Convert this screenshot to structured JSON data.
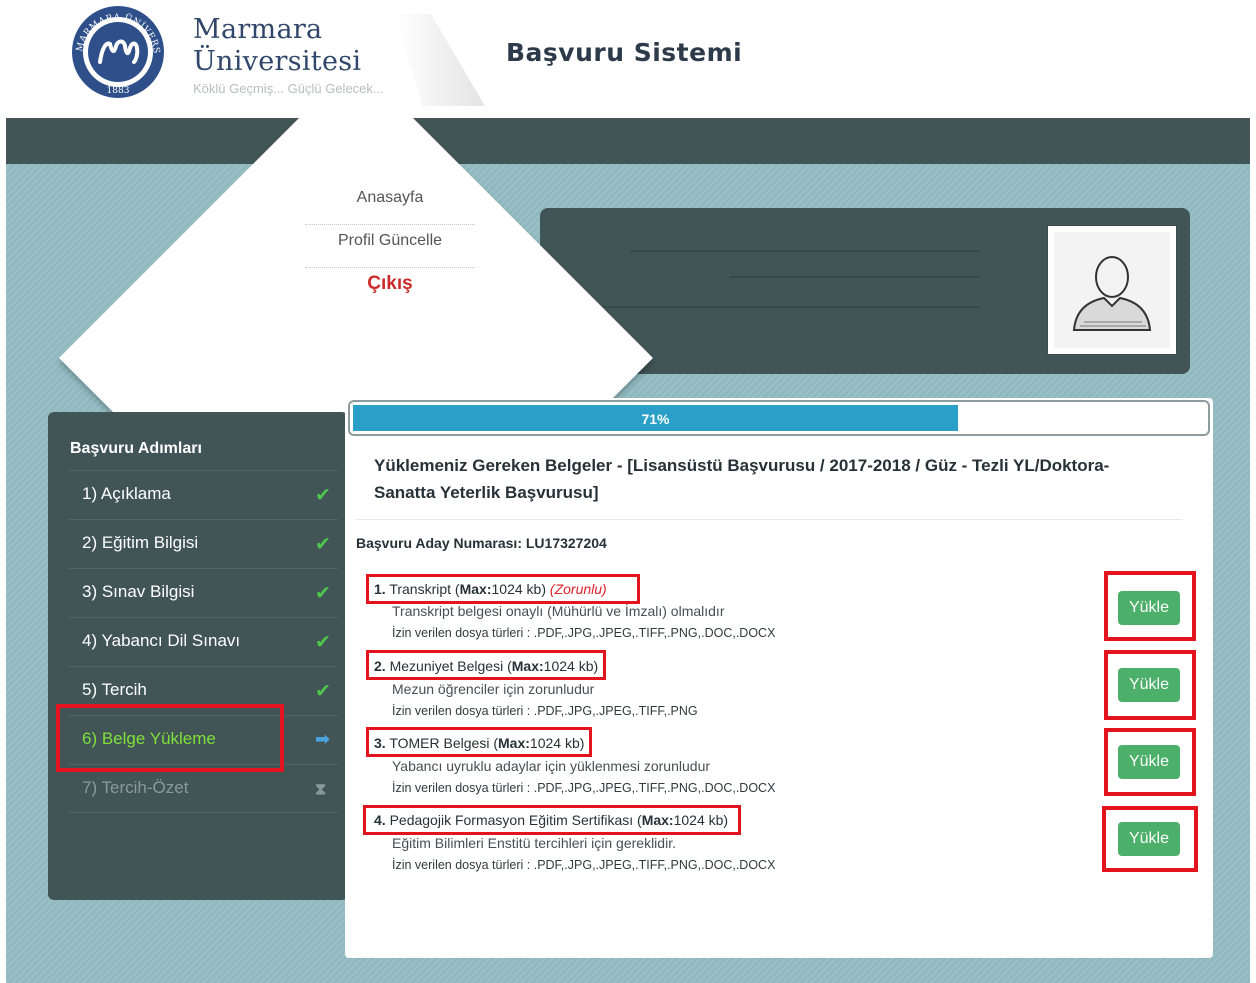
{
  "header": {
    "university_line1": "Marmara",
    "university_line2": "Üniversitesi",
    "motto": "Köklü Geçmiş... Güçlü Gelecek...",
    "system_title": "Başvuru Sistemi",
    "seal_text": "MARMARA ÜNİVERSİTESİ",
    "seal_year": "1883"
  },
  "nav": {
    "home": "Anasayfa",
    "profile": "Profil Güncelle",
    "logout": "Çıkış"
  },
  "sidebar": {
    "title": "Başvuru Adımları",
    "steps": [
      {
        "label": "1) Açıklama",
        "status": "done",
        "icon": "check-icon"
      },
      {
        "label": "2) Eğitim Bilgisi",
        "status": "done",
        "icon": "check-icon"
      },
      {
        "label": "3) Sınav Bilgisi",
        "status": "done",
        "icon": "check-icon"
      },
      {
        "label": "4) Yabancı Dil Sınavı",
        "status": "done",
        "icon": "check-icon"
      },
      {
        "label": "5) Tercih",
        "status": "done",
        "icon": "check-icon"
      },
      {
        "label": "6) Belge Yükleme",
        "status": "active",
        "icon": "arrow-right-icon"
      },
      {
        "label": "7) Tercih-Özet",
        "status": "pending",
        "icon": "hourglass-icon"
      }
    ]
  },
  "progress": {
    "value": 0.71,
    "label": "71%"
  },
  "content": {
    "title": "Yüklemeniz Gereken Belgeler - [Lisansüstü Başvurusu / 2017-2018 / Güz - Tezli YL/Doktora-Sanatta Yeterlik Başvurusu]",
    "aday_no": "Başvuru Aday Numarası: LU17327204",
    "max_label": "Max:",
    "upload_label": "Yükle",
    "documents": [
      {
        "num": "1.",
        "name": "Transkript",
        "max": "1024 kb",
        "required": "(Zorunlu)",
        "desc": "Transkript belgesi onaylı (Mühürlü ve İmzalı) olmalıdır",
        "types": "İzin verilen dosya türleri : .PDF,.JPG,.JPEG,.TIFF,.PNG,.DOC,.DOCX"
      },
      {
        "num": "2.",
        "name": "Mezuniyet Belgesi",
        "max": "1024 kb",
        "required": "",
        "desc": "Mezun öğrenciler için zorunludur",
        "types": "İzin verilen dosya türleri : .PDF,.JPG,.JPEG,.TIFF,.PNG"
      },
      {
        "num": "3.",
        "name": "TOMER Belgesi",
        "max": "1024 kb",
        "required": "",
        "desc": "Yabancı uyruklu adaylar için yüklenmesi zorunludur",
        "types": "İzin verilen dosya türleri : .PDF,.JPG,.JPEG,.TIFF,.PNG,.DOC,.DOCX"
      },
      {
        "num": "4.",
        "name": "Pedagojik Formasyon Eğitim Sertifikası",
        "max": "1024 kb",
        "required": "",
        "desc": "Eğitim Bilimleri Enstitü tercihleri için gereklidir.",
        "types": "İzin verilen dosya türleri : .PDF,.JPG,.JPEG,.TIFF,.PNG,.DOC,.DOCX"
      }
    ]
  },
  "colors": {
    "accent_blue": "#2aa0c8",
    "button_green": "#4db06a",
    "highlight_red": "#e4141e",
    "panel_dark": "#415456"
  }
}
